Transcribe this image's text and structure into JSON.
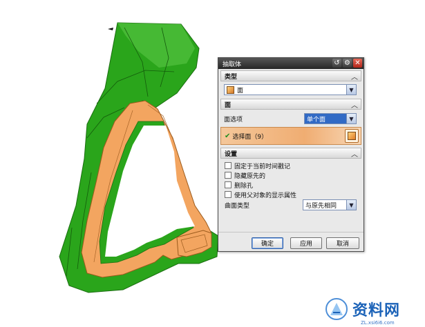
{
  "dialog": {
    "title": "抽取体",
    "sections": {
      "type": {
        "label": "类型",
        "selected": "面"
      },
      "face": {
        "label": "面",
        "face_option_label": "面选项",
        "face_option_value": "单个面",
        "select_label": "选择面（9）"
      },
      "settings": {
        "label": "设置",
        "checkboxes": [
          "固定于当前时间戳记",
          "隐藏原先的",
          "删除孔",
          "使用父对象的显示属性"
        ],
        "surface_type_label": "曲面类型",
        "surface_type_value": "与原先相同"
      }
    },
    "buttons": {
      "ok": "确定",
      "apply": "应用",
      "cancel": "取消"
    }
  },
  "watermark": {
    "text": "资料网",
    "url": "ZL.xsi6i6.com"
  },
  "colors": {
    "model_green": "#2aa51b",
    "face_orange": "#f3a560",
    "title_bar": "#3a3a3a"
  }
}
